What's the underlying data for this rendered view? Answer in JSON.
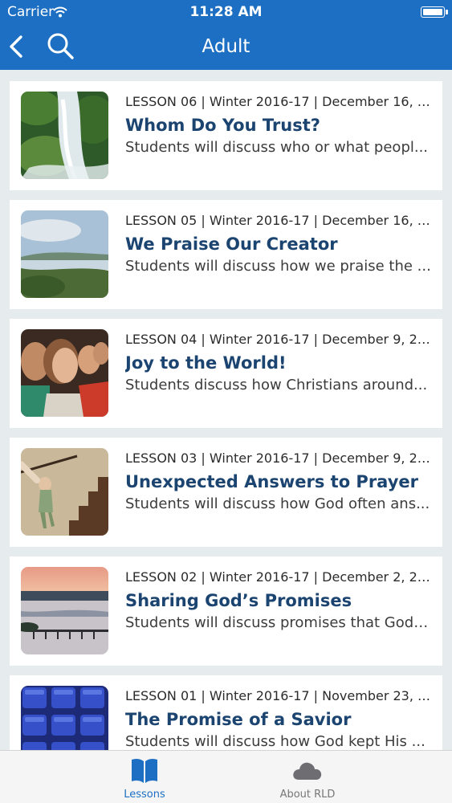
{
  "status_bar": {
    "carrier": "Carrier",
    "time": "11:28 AM"
  },
  "nav": {
    "title": "Adult",
    "back_icon": "chevron-left-icon",
    "search_icon": "search-icon"
  },
  "lessons": [
    {
      "meta": "LESSON 06 | Winter 2016-17 | December 16, 2...",
      "title": "Whom Do You Trust?",
      "description": "Students will discuss who or what peopl..."
    },
    {
      "meta": "LESSON 05 | Winter 2016-17 | December 16, 2...",
      "title": "We Praise Our Creator",
      "description": "Students will discuss how we praise the ..."
    },
    {
      "meta": "LESSON 04 | Winter 2016-17 | December 9, 20...",
      "title": "Joy to the World!",
      "description": "Students discuss how Christians around..."
    },
    {
      "meta": "LESSON 03 | Winter 2016-17 | December 9, 20...",
      "title": "Unexpected Answers to Prayer",
      "description": "Students will discuss how God often ans..."
    },
    {
      "meta": "LESSON 02 | Winter 2016-17 | December 2, 20...",
      "title": "Sharing God’s Promises",
      "description": "Students will discuss promises that God ..."
    },
    {
      "meta": "LESSON 01 | Winter 2016-17 | November 23, 2...",
      "title": "The Promise of a Savior",
      "description": "Students will discuss how God kept His ..."
    }
  ],
  "tabbar": {
    "lessons_label": "Lessons",
    "lessons_icon": "book-icon",
    "about_label": "About RLD",
    "about_icon": "cloud-icon"
  },
  "colors": {
    "brand": "#1c6fc2",
    "title_text": "#1b4470",
    "background": "#e6ebee"
  }
}
